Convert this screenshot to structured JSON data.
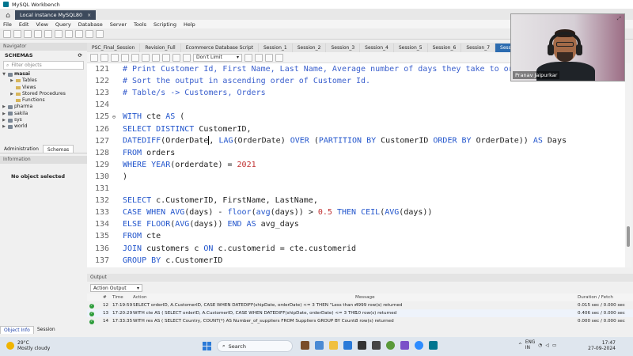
{
  "window": {
    "title": "MySQL Workbench"
  },
  "connection_tab": {
    "label": "Local instance MySQL80",
    "close": "×"
  },
  "menu": [
    "File",
    "Edit",
    "View",
    "Query",
    "Database",
    "Server",
    "Tools",
    "Scripting",
    "Help"
  ],
  "navigator": {
    "header": "Navigator",
    "schemas_label": "SCHEMAS",
    "filter_placeholder": "Filter objects",
    "tree": [
      {
        "label": "masai",
        "level": 0,
        "bold": true,
        "expanded": true,
        "type": "db"
      },
      {
        "label": "Tables",
        "level": 1,
        "type": "folder"
      },
      {
        "label": "Views",
        "level": 1,
        "type": "folder"
      },
      {
        "label": "Stored Procedures",
        "level": 1,
        "type": "folder"
      },
      {
        "label": "Functions",
        "level": 1,
        "type": "folder"
      },
      {
        "label": "pharma",
        "level": 0,
        "type": "db"
      },
      {
        "label": "sakila",
        "level": 0,
        "type": "db"
      },
      {
        "label": "sys",
        "level": 0,
        "type": "db"
      },
      {
        "label": "world",
        "level": 0,
        "type": "db"
      }
    ],
    "tabs": [
      "Administration",
      "Schemas"
    ],
    "info_header": "Information",
    "info_text": "No object selected",
    "bottom_tabs": [
      "Object Info",
      "Session"
    ]
  },
  "editor_tabs": [
    "PSC_Final_Session",
    "Revision_Full",
    "Ecommerce Database Script",
    "Session_1",
    "Session_2",
    "Session_3",
    "Session_4",
    "Session_5",
    "Session_6",
    "Session_7",
    "Sessio"
  ],
  "editor_toolbar": {
    "limit": "Don't Limit"
  },
  "code_lines": [
    {
      "n": "121",
      "fold": "",
      "html": "<span class='cm'># Print Customer Id, First Name, Last Name, Average number of days they take to order</span>"
    },
    {
      "n": "122",
      "fold": "",
      "html": "<span class='cm'># Sort the output in ascending order of Customer Id.</span>"
    },
    {
      "n": "123",
      "fold": "",
      "html": "<span class='cm'># Table/s -&gt; Customers, Orders</span>"
    },
    {
      "n": "124",
      "fold": "",
      "html": ""
    },
    {
      "n": "125",
      "fold": "⊖",
      "html": "<span class='kw'>WITH</span> cte <span class='kw'>AS</span> ("
    },
    {
      "n": "126",
      "fold": "",
      "html": "<span class='kw'>SELECT DISTINCT</span> CustomerID,"
    },
    {
      "n": "127",
      "fold": "",
      "html": "<span class='fn'>DATEDIFF</span>(OrderDate<span class='caret'></span>, <span class='fn'>LAG</span>(OrderDate) <span class='kw'>OVER</span> (<span class='kw'>PARTITION BY</span> CustomerID <span class='kw'>ORDER BY</span> OrderDate)) <span class='kw'>AS</span> Days"
    },
    {
      "n": "128",
      "fold": "",
      "html": "<span class='kw'>FROM</span> orders"
    },
    {
      "n": "129",
      "fold": "",
      "html": "<span class='kw'>WHERE</span> <span class='fn'>YEAR</span>(orderdate) = <span class='num'>2021</span>"
    },
    {
      "n": "130",
      "fold": "",
      "html": ")"
    },
    {
      "n": "131",
      "fold": "",
      "html": ""
    },
    {
      "n": "132",
      "fold": "",
      "html": "<span class='kw'>SELECT</span> c.CustomerID, FirstName, LastName,"
    },
    {
      "n": "133",
      "fold": "",
      "html": "<span class='kw'>CASE WHEN</span> <span class='fn'>AVG</span>(days) - <span class='fn'>floor</span>(<span class='fn'>avg</span>(days)) &gt; <span class='num'>0.5</span> <span class='kw'>THEN</span> <span class='fn'>CEIL</span>(<span class='fn'>AVG</span>(days))"
    },
    {
      "n": "134",
      "fold": "",
      "html": "<span class='kw'>ELSE</span> <span class='fn'>FLOOR</span>(<span class='fn'>AVG</span>(days)) <span class='kw'>END AS</span> avg_days"
    },
    {
      "n": "135",
      "fold": "",
      "html": "<span class='kw'>FROM</span> cte"
    },
    {
      "n": "136",
      "fold": "",
      "html": "<span class='kw'>JOIN</span> customers c <span class='kw'>ON</span> c.customerid = cte.customerid"
    },
    {
      "n": "137",
      "fold": "",
      "html": "<span class='kw'>GROUP BY</span> c.CustomerID"
    }
  ],
  "output": {
    "header": "Output",
    "select_label": "Action Output",
    "columns": {
      "num": "#",
      "time": "Time",
      "action": "Action",
      "message": "Message",
      "duration": "Duration / Fetch"
    },
    "rows": [
      {
        "num": "12",
        "time": "17:19:59",
        "action": "SELECT orderID, A.CustomerID, CASE WHEN DATEDIFF(shipDate, orderDate) <= 3 THEN \"Less than or equ...",
        "message": "4999 row(s) returned",
        "duration": "0.015 sec / 0.000 sec"
      },
      {
        "num": "13",
        "time": "17:20:29",
        "action": "WITH cte AS ( SELECT orderID, A.CustomerID, CASE WHEN DATEDIFF(shipDate, orderDate) <= 3 THEN \"L...",
        "message": "10 row(s) returned",
        "duration": "0.406 sec / 0.000 sec"
      },
      {
        "num": "14",
        "time": "17:33:35",
        "action": "WITH res AS ( SELECT Country, COUNT(*) AS Number_of_suppliers FROM Suppliers  GROUP BY Country ) ...",
        "message": "3 row(s) returned",
        "duration": "0.000 sec / 0.000 sec"
      }
    ]
  },
  "webcam": {
    "name": "Pranav Jaipurkar"
  },
  "taskbar": {
    "weather_temp": "29°C",
    "weather_desc": "Mostly cloudy",
    "search_placeholder": "Search",
    "lang_top": "ENG",
    "lang_bottom": "IN",
    "time": "17:47",
    "date": "27-09-2024"
  }
}
